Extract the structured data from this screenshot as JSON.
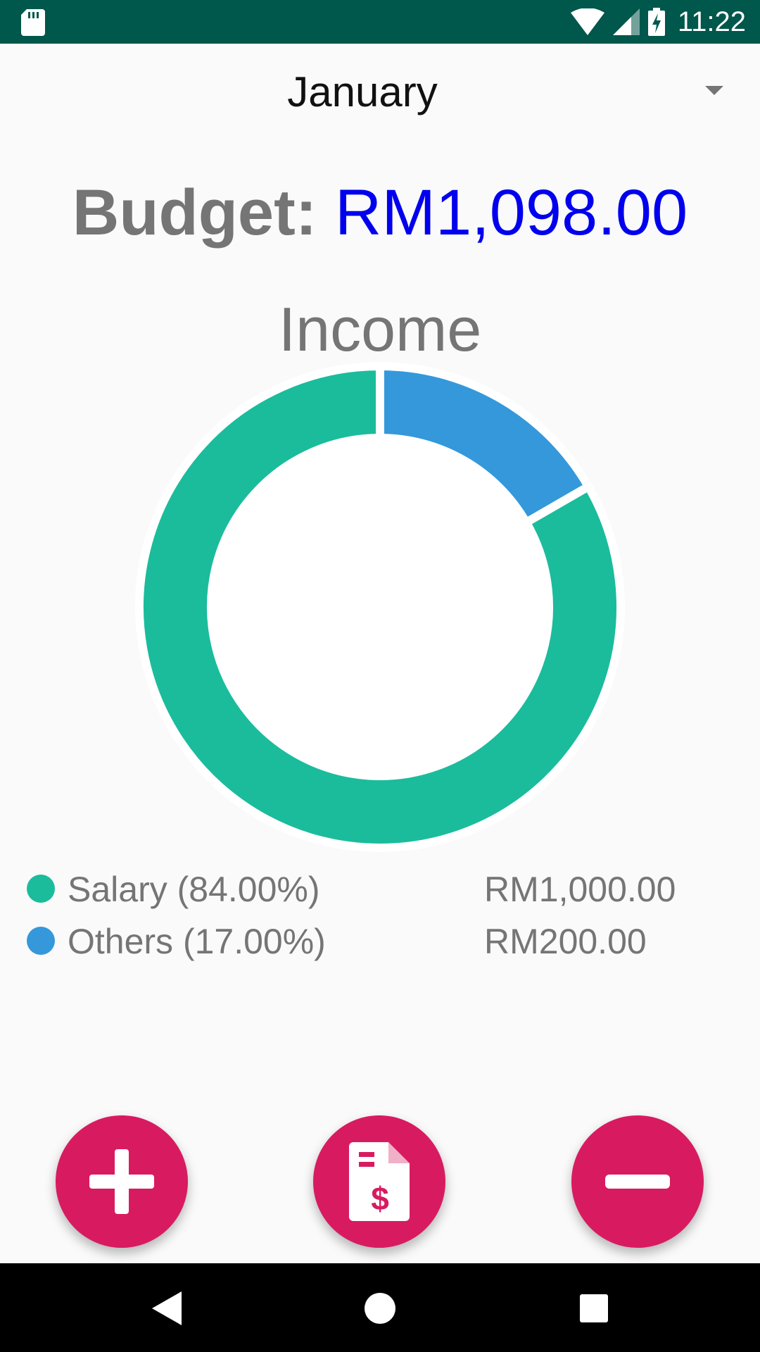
{
  "status_bar": {
    "time": "11:22",
    "icons": [
      "sd-card-icon",
      "wifi-icon",
      "signal-icon",
      "battery-charging-icon"
    ],
    "background": "#00574b"
  },
  "month_selector": {
    "selected": "January"
  },
  "budget": {
    "label": "Budget:",
    "value": "RM1,098.00",
    "value_color": "#0000ee"
  },
  "chart_data": {
    "type": "pie",
    "style": "donut",
    "title": "Income",
    "categories": [
      "Salary",
      "Others"
    ],
    "values": [
      1000,
      200
    ],
    "percentages": [
      84.0,
      17.0
    ],
    "colors": [
      "#1abc9c",
      "#3498db"
    ],
    "legend_position": "bottom"
  },
  "legend": [
    {
      "label": "Salary (84.00%)",
      "amount": "RM1,000.00",
      "color": "#1abc9c"
    },
    {
      "label": "Others (17.00%)",
      "amount": "RM200.00",
      "color": "#3498db"
    }
  ],
  "actions": {
    "add_icon": "plus-icon",
    "report_icon": "invoice-dollar-icon",
    "remove_icon": "minus-icon",
    "accent": "#d81b60"
  },
  "nav_bar": {
    "icons": [
      "back-icon",
      "home-icon",
      "recents-icon"
    ]
  }
}
